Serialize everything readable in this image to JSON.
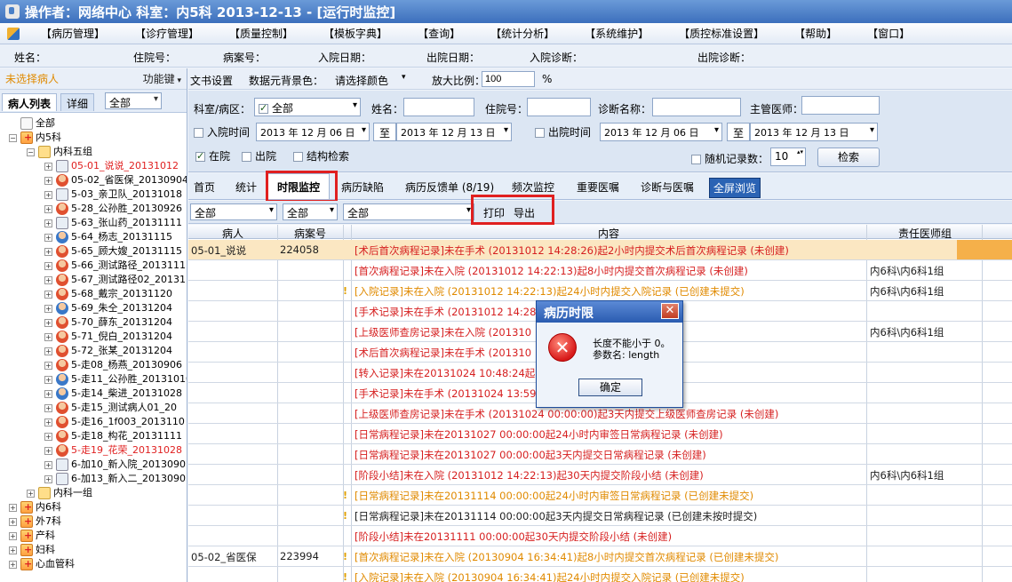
{
  "window": {
    "title": "操作者：网络中心  科室：内5科  2013-12-13 - [运行时监控]"
  },
  "menu": [
    "【病历管理】",
    "【诊疗管理】",
    "【质量控制】",
    "【模板字典】",
    "【查询】",
    "【统计分析】",
    "【系统维护】",
    "【质控标准设置】",
    "【帮助】",
    "【窗口】"
  ],
  "patient_info": {
    "name": "姓名：",
    "admission_no": "住院号：",
    "record_no": "病案号：",
    "admit_date": "入院日期：",
    "discharge_date": "出院日期：",
    "admit_diag": "入院诊断：",
    "discharge_diag": "出院诊断："
  },
  "left_panel": {
    "no_patient": "未选择病人",
    "func_key": "功能键",
    "tab_list": "病人列表",
    "tab_detail": "详细",
    "filter_value": "全部",
    "tree": [
      {
        "label": "全部",
        "level": 0,
        "icon": "check",
        "exp": ""
      },
      {
        "label": "内5科",
        "level": 0,
        "icon": "dept",
        "exp": "−"
      },
      {
        "label": "内科五组",
        "level": 1,
        "icon": "group",
        "exp": "−"
      },
      {
        "label": "05-01_说说_20131012",
        "level": 2,
        "icon": "walk",
        "exp": "+",
        "red": true
      },
      {
        "label": "05-02_省医保_20130904",
        "level": 2,
        "icon": "person",
        "exp": "+"
      },
      {
        "label": "5-03_亲卫队_20131018",
        "level": 2,
        "icon": "walk",
        "exp": "+"
      },
      {
        "label": "5-28_公孙胜_20130926",
        "level": 2,
        "icon": "person",
        "exp": "+"
      },
      {
        "label": "5-63_张山药_20131111",
        "level": 2,
        "icon": "walk",
        "exp": "+"
      },
      {
        "label": "5-64_杨志_20131115",
        "level": 2,
        "icon": "person-blue",
        "exp": "+"
      },
      {
        "label": "5-65_顾大嫂_20131115",
        "level": 2,
        "icon": "person",
        "exp": "+"
      },
      {
        "label": "5-66_测试路径_20131111",
        "level": 2,
        "icon": "person",
        "exp": "+"
      },
      {
        "label": "5-67_测试路径02_20131",
        "level": 2,
        "icon": "person",
        "exp": "+"
      },
      {
        "label": "5-68_戴宗_20131120",
        "level": 2,
        "icon": "person",
        "exp": "+"
      },
      {
        "label": "5-69_朱仝_20131204",
        "level": 2,
        "icon": "person-blue",
        "exp": "+"
      },
      {
        "label": "5-70_薛东_20131204",
        "level": 2,
        "icon": "person",
        "exp": "+"
      },
      {
        "label": "5-71_倪白_20131204",
        "level": 2,
        "icon": "person",
        "exp": "+"
      },
      {
        "label": "5-72_张某_20131204",
        "level": 2,
        "icon": "person",
        "exp": "+"
      },
      {
        "label": "5-走08_杨燕_20130906",
        "level": 2,
        "icon": "person",
        "exp": "+"
      },
      {
        "label": "5-走11_公孙胜_20131010",
        "level": 2,
        "icon": "person-blue",
        "exp": "+"
      },
      {
        "label": "5-走14_柴进_20131028",
        "level": 2,
        "icon": "person-blue",
        "exp": "+"
      },
      {
        "label": "5-走15_测试病人01_20",
        "level": 2,
        "icon": "person",
        "exp": "+"
      },
      {
        "label": "5-走16_1f003_2013110",
        "level": 2,
        "icon": "person",
        "exp": "+"
      },
      {
        "label": "5-走18_构花_20131111",
        "level": 2,
        "icon": "person",
        "exp": "+"
      },
      {
        "label": "5-走19_花荣_20131028",
        "level": 2,
        "icon": "person",
        "exp": "+",
        "red": true
      },
      {
        "label": "6-加10_新入院_2013090",
        "level": 2,
        "icon": "walk",
        "exp": "+"
      },
      {
        "label": "6-加13_新入二_2013090",
        "level": 2,
        "icon": "walk",
        "exp": "+"
      },
      {
        "label": "内科一组",
        "level": 1,
        "icon": "group",
        "exp": "+"
      },
      {
        "label": "内6科",
        "level": 0,
        "icon": "dept",
        "exp": "+"
      },
      {
        "label": "外7科",
        "level": 0,
        "icon": "dept",
        "exp": "+"
      },
      {
        "label": "产科",
        "level": 0,
        "icon": "dept",
        "exp": "+"
      },
      {
        "label": "妇科",
        "level": 0,
        "icon": "dept",
        "exp": "+"
      },
      {
        "label": "心血管科",
        "level": 0,
        "icon": "dept",
        "exp": "+"
      }
    ]
  },
  "toolbar": {
    "doc_settings": "文书设置",
    "element_bg": "数据元背景色：",
    "choose_color": "请选择颜色",
    "zoom_label": "放大比例：",
    "zoom_value": "100",
    "percent": "%"
  },
  "filter": {
    "dept_label": "科室/病区：",
    "dept_value": "全部",
    "name_label": "姓名：",
    "admission_label": "住院号：",
    "diag_label": "诊断名称：",
    "doctor_label": "主管医师：",
    "admit_time_label": "入院时间",
    "admit_from": "2013 年 12 月 06 日",
    "to": "至",
    "admit_to": "2013 年 12 月 13 日",
    "discharge_time_label": "出院时间",
    "discharge_from": "2013 年 12 月 06 日",
    "discharge_to": "2013 年 12 月 13 日",
    "in_hospital": "在院",
    "discharged": "出院",
    "structured_search": "结构检索",
    "random_label": "随机记录数：",
    "random_value": "10",
    "search_button": "检索"
  },
  "tabs": [
    "首页",
    "统计",
    "时限监控",
    "病历缺陷",
    "病历反馈单 (8/19)",
    "频次监控",
    "重要医嘱",
    "诊断与医嘱",
    "全屏浏览"
  ],
  "actions": {
    "sel1": "全部",
    "sel2": "全部",
    "sel3": "全部",
    "print": "打印",
    "export": "导出"
  },
  "table": {
    "headers": [
      "病人",
      "病案号",
      "内容",
      "责任医师组"
    ],
    "rows": [
      {
        "patient": "05-01_说说",
        "record": "224058",
        "content": "[术后首次病程记录]未在手术 (20131012  14:28:26)起2小时内提交术后首次病程记录 (未创建)",
        "color": "red",
        "flag": false,
        "group": ""
      },
      {
        "patient": "",
        "record": "",
        "content": "[首次病程记录]未在入院 (20131012  14:22:13)起8小时内提交首次病程记录 (未创建)",
        "color": "red",
        "flag": false,
        "group": "内6科\\内6科1组"
      },
      {
        "patient": "",
        "record": "",
        "content": "[入院记录]未在入院 (20131012  14:22:13)起24小时内提交入院记录 (已创建未提交)",
        "color": "orange",
        "flag": true,
        "group": "内6科\\内6科1组"
      },
      {
        "patient": "",
        "record": "",
        "content": "[手术记录]未在手术 (20131012  14:28:",
        "color": "red",
        "flag": false,
        "group": ""
      },
      {
        "patient": "",
        "record": "",
        "content": "[上级医师查房记录]未在入院 (201310",
        "color": "red",
        "flag": false,
        "group": "内6科\\内6科1组"
      },
      {
        "patient": "",
        "record": "",
        "content": "[术后首次病程记录]未在手术 (201310",
        "color": "red",
        "flag": false,
        "group": ""
      },
      {
        "patient": "",
        "record": "",
        "content": "[转入记录]未在20131024  10:48:24起",
        "color": "red",
        "flag": false,
        "group": ""
      },
      {
        "patient": "",
        "record": "",
        "content": "[手术记录]未在手术 (20131024  13:59:",
        "color": "red",
        "flag": false,
        "group": ""
      },
      {
        "patient": "",
        "record": "",
        "content": "[上级医师查房记录]未在手术 (20131024  00:00:00)起3天内提交上级医师查房记录 (未创建)",
        "color": "red",
        "flag": false,
        "group": ""
      },
      {
        "patient": "",
        "record": "",
        "content": "[日常病程记录]未在20131027  00:00:00起24小时内审签日常病程记录 (未创建)",
        "color": "red",
        "flag": false,
        "group": ""
      },
      {
        "patient": "",
        "record": "",
        "content": "[日常病程记录]未在20131027  00:00:00起3天内提交日常病程记录 (未创建)",
        "color": "red",
        "flag": false,
        "group": ""
      },
      {
        "patient": "",
        "record": "",
        "content": "[阶段小结]未在入院 (20131012  14:22:13)起30天内提交阶段小结 (未创建)",
        "color": "red",
        "flag": false,
        "group": "内6科\\内6科1组"
      },
      {
        "patient": "",
        "record": "",
        "content": "[日常病程记录]未在20131114  00:00:00起24小时内审签日常病程记录 (已创建未提交)",
        "color": "orange",
        "flag": true,
        "group": ""
      },
      {
        "patient": "",
        "record": "",
        "content": "[日常病程记录]未在20131114  00:00:00起3天内提交日常病程记录 (已创建未按时提交)",
        "color": "black",
        "flag": true,
        "group": ""
      },
      {
        "patient": "",
        "record": "",
        "content": "[阶段小结]未在20131111  00:00:00起30天内提交阶段小结 (未创建)",
        "color": "red",
        "flag": false,
        "group": ""
      },
      {
        "patient": "05-02_省医保",
        "record": "223994",
        "content": "[首次病程记录]未在入院 (20130904  16:34:41)起8小时内提交首次病程记录 (已创建未提交)",
        "color": "orange",
        "flag": true,
        "group": ""
      },
      {
        "patient": "",
        "record": "",
        "content": "[入院记录]未在入院 (20130904  16:34:41)起24小时内提交入院记录 (已创建未提交)",
        "color": "orange",
        "flag": true,
        "group": ""
      }
    ]
  },
  "dialog": {
    "title": "病历时限",
    "line1": "长度不能小于 0。",
    "line2": "参数名: length",
    "ok": "确定"
  }
}
